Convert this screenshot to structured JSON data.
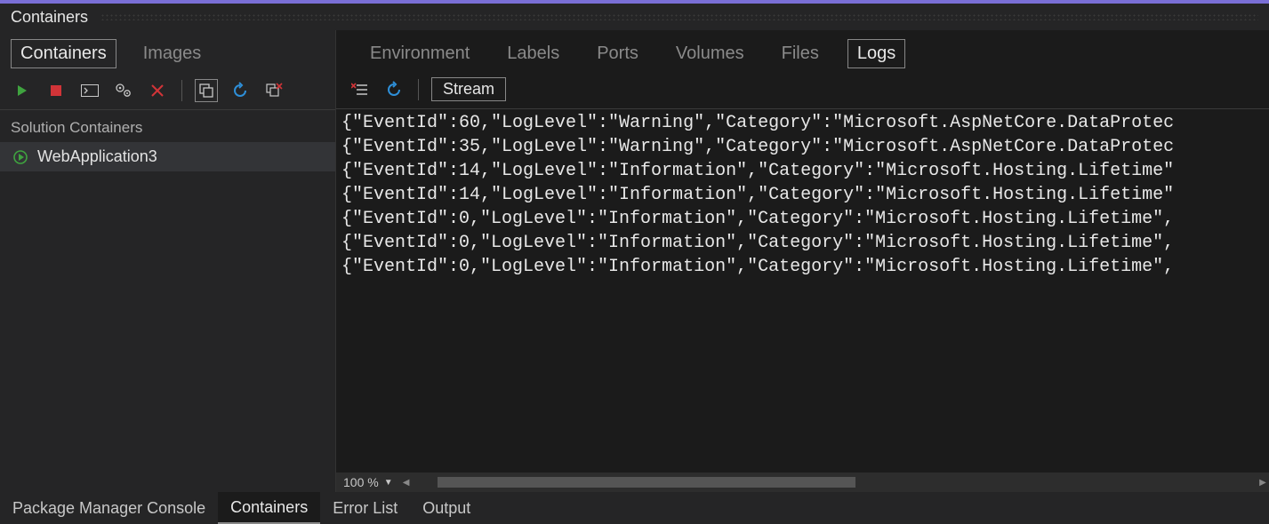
{
  "panel_title": "Containers",
  "left": {
    "subtabs": [
      {
        "label": "Containers",
        "active": true
      },
      {
        "label": "Images",
        "active": false
      }
    ],
    "section_header": "Solution Containers",
    "items": [
      {
        "name": "WebApplication3",
        "status": "running"
      }
    ]
  },
  "right": {
    "tabs": [
      {
        "label": "Environment",
        "active": false
      },
      {
        "label": "Labels",
        "active": false
      },
      {
        "label": "Ports",
        "active": false
      },
      {
        "label": "Volumes",
        "active": false
      },
      {
        "label": "Files",
        "active": false
      },
      {
        "label": "Logs",
        "active": true
      }
    ],
    "stream_label": "Stream",
    "zoom": "100 %",
    "logs": [
      "{\"EventId\":60,\"LogLevel\":\"Warning\",\"Category\":\"Microsoft.AspNetCore.DataProtec",
      "{\"EventId\":35,\"LogLevel\":\"Warning\",\"Category\":\"Microsoft.AspNetCore.DataProtec",
      "{\"EventId\":14,\"LogLevel\":\"Information\",\"Category\":\"Microsoft.Hosting.Lifetime\"",
      "{\"EventId\":14,\"LogLevel\":\"Information\",\"Category\":\"Microsoft.Hosting.Lifetime\"",
      "{\"EventId\":0,\"LogLevel\":\"Information\",\"Category\":\"Microsoft.Hosting.Lifetime\",",
      "{\"EventId\":0,\"LogLevel\":\"Information\",\"Category\":\"Microsoft.Hosting.Lifetime\",",
      "{\"EventId\":0,\"LogLevel\":\"Information\",\"Category\":\"Microsoft.Hosting.Lifetime\","
    ]
  },
  "bottom_tabs": [
    {
      "label": "Package Manager Console",
      "active": false
    },
    {
      "label": "Containers",
      "active": true
    },
    {
      "label": "Error List",
      "active": false
    },
    {
      "label": "Output",
      "active": false
    }
  ]
}
